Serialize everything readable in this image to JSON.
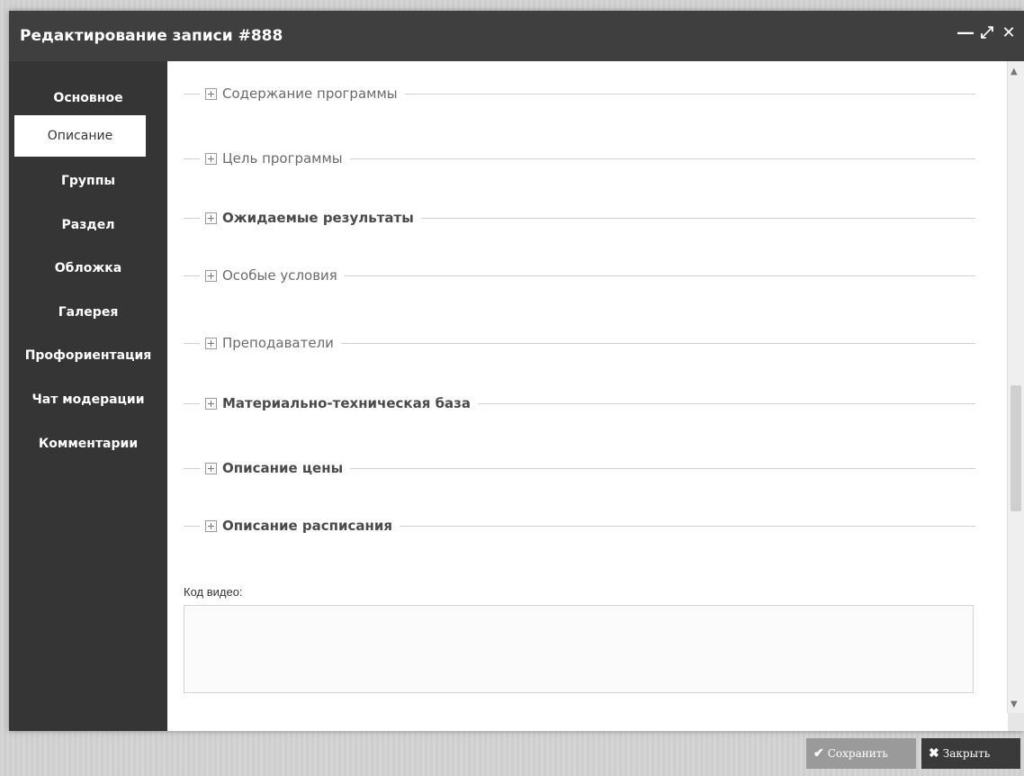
{
  "window": {
    "title": "Редактирование записи #888",
    "controls": {
      "minimize_icon": "minimize-icon",
      "maximize_icon": "maximize-icon",
      "close_icon": "close-icon"
    }
  },
  "sidebar": {
    "items": [
      {
        "label": "Основное"
      },
      {
        "label": "Описание",
        "active": true
      },
      {
        "label": "Группы"
      },
      {
        "label": "Раздел"
      },
      {
        "label": "Обложка"
      },
      {
        "label": "Галерея"
      },
      {
        "label": "Профориентация"
      },
      {
        "label": "Чат модерации"
      },
      {
        "label": "Комментарии"
      }
    ]
  },
  "sections": [
    {
      "label": "Содержание программы"
    },
    {
      "label": "Цель программы"
    },
    {
      "label": "Ожидаемые результаты"
    },
    {
      "label": "Особые условия"
    },
    {
      "label": "Преподаватели"
    },
    {
      "label": "Материально-техническая база"
    },
    {
      "label": "Описание цены"
    },
    {
      "label": "Описание расписания"
    }
  ],
  "video": {
    "label": "Код видео:",
    "value": ""
  },
  "footer": {
    "save_label": "Сохранить",
    "close_label": "Закрыть"
  },
  "colors": {
    "titlebar": "#3f3f3f",
    "sidebar": "#353535",
    "save_button": "#9a9a9a",
    "close_button": "#3a3a3a"
  }
}
